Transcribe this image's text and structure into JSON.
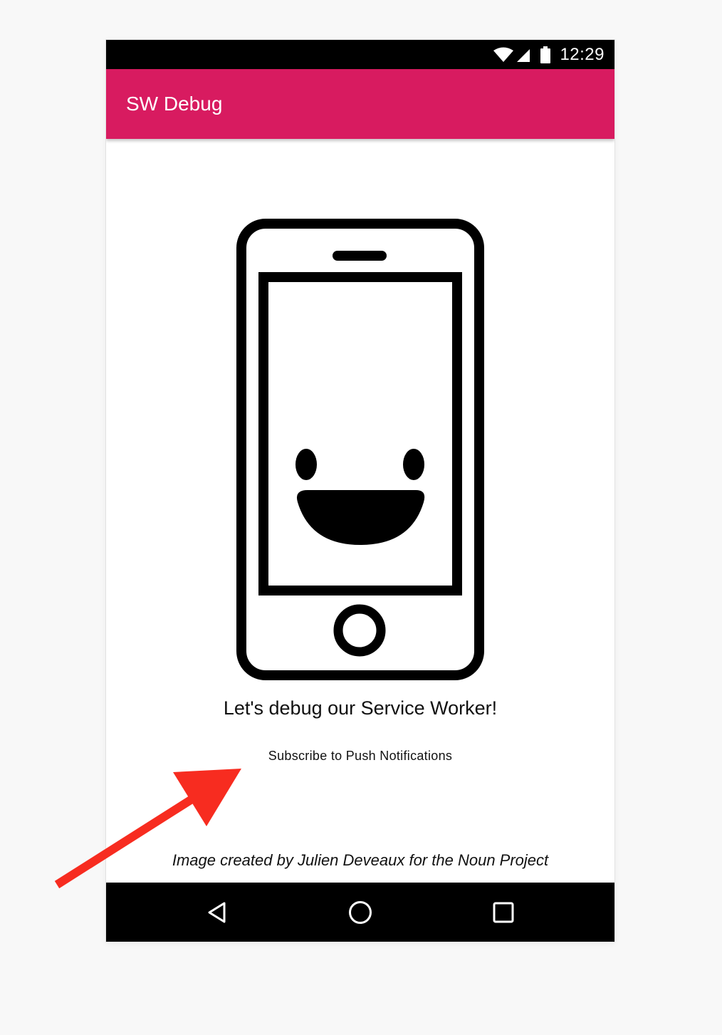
{
  "status_bar": {
    "time": "12:29",
    "icons": [
      "wifi-icon",
      "cell-signal-icon",
      "battery-icon"
    ]
  },
  "app_bar": {
    "title": "SW Debug",
    "color": "#d81b60"
  },
  "main": {
    "illustration": "smiling-phone-illustration",
    "headline": "Let's debug our Service Worker!",
    "subscribe_label": "Subscribe to Push Notifications",
    "credit": "Image created by Julien Deveaux for the Noun Project"
  },
  "nav_bar": {
    "icons": [
      "back-icon",
      "home-icon",
      "recents-icon"
    ]
  },
  "annotation": {
    "arrow_color": "#f72c20",
    "points_to": "subscribe-button"
  }
}
